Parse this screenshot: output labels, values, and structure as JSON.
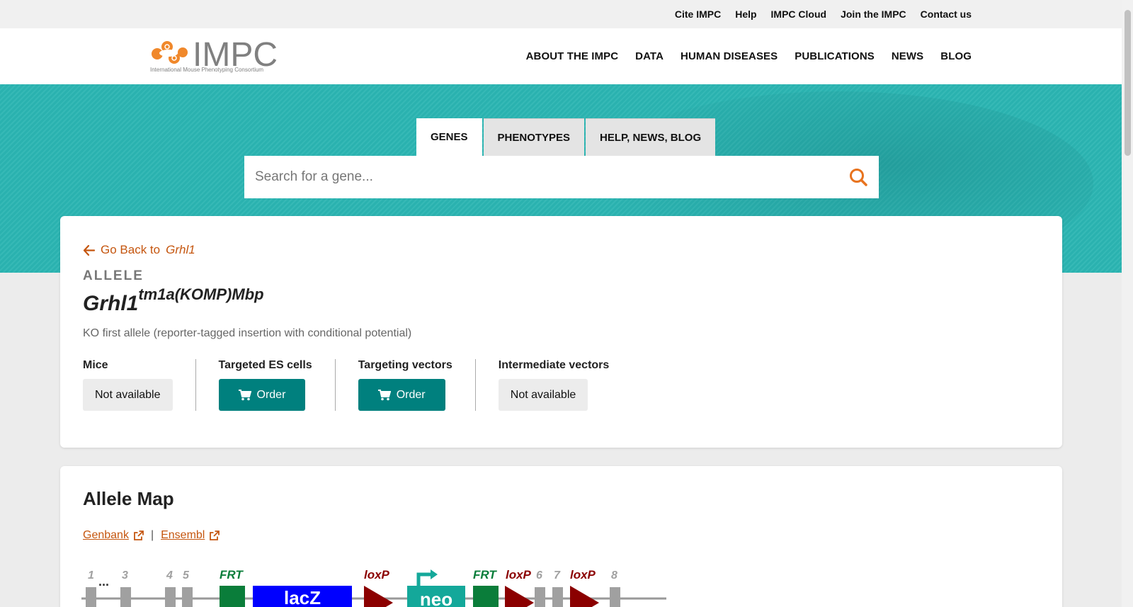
{
  "top_links": [
    "Cite IMPC",
    "Help",
    "IMPC Cloud",
    "Join the IMPC",
    "Contact us"
  ],
  "logo": {
    "text": "IMPC",
    "subtitle": "International Mouse Phenotyping Consortium"
  },
  "main_nav": [
    "ABOUT THE IMPC",
    "DATA",
    "HUMAN DISEASES",
    "PUBLICATIONS",
    "NEWS",
    "BLOG"
  ],
  "search": {
    "tabs": [
      "GENES",
      "PHENOTYPES",
      "HELP, NEWS, BLOG"
    ],
    "active_tab": "GENES",
    "placeholder": "Search for a gene..."
  },
  "allele": {
    "back_prefix": "Go Back to",
    "back_gene": "Grhl1",
    "label": "ALLELE",
    "gene": "Grhl1",
    "superscript": "tm1a(KOMP)Mbp",
    "description": "KO first allele (reporter-tagged insertion with conditional potential)",
    "products": [
      {
        "title": "Mice",
        "button": "Not available",
        "type": "na"
      },
      {
        "title": "Targeted ES cells",
        "button": "Order",
        "type": "order"
      },
      {
        "title": "Targeting vectors",
        "button": "Order",
        "type": "order"
      },
      {
        "title": "Intermediate vectors",
        "button": "Not available",
        "type": "na"
      }
    ]
  },
  "allele_map": {
    "title": "Allele Map",
    "links": [
      "Genbank",
      "Ensembl"
    ],
    "separator": "|",
    "labels": {
      "exon_1": "1",
      "exon_3": "3",
      "exon_4": "4",
      "exon_5": "5",
      "exon_6": "6",
      "exon_7": "7",
      "exon_8": "8",
      "frt": "FRT",
      "loxp": "loxP",
      "lacz": "lacZ",
      "neo": "neo",
      "ellipsis": "..."
    },
    "colors": {
      "exon": "#a0a0a0",
      "frt": "#0a7d3a",
      "loxp": "#8b0000",
      "lacz": "#0000ff",
      "neo": "#14a89a",
      "line": "#999999"
    }
  },
  "colors": {
    "accent": "#c5560f",
    "teal": "#00807e",
    "hero": "#2bb5b2"
  }
}
